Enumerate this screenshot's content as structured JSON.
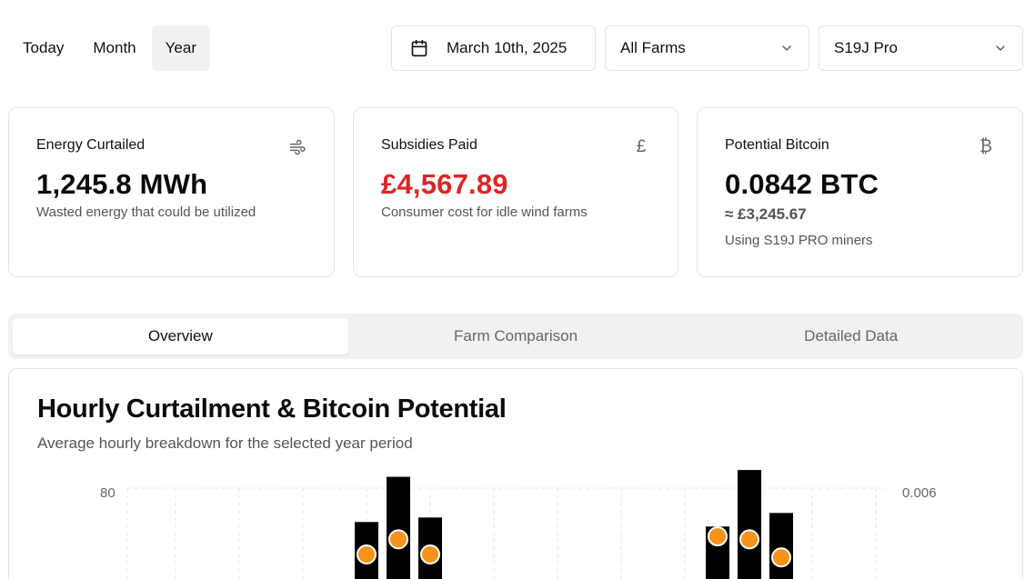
{
  "period_tabs": [
    {
      "label": "Today",
      "active": false
    },
    {
      "label": "Month",
      "active": false
    },
    {
      "label": "Year",
      "active": true
    }
  ],
  "date_picker": {
    "value": "March 10th, 2025",
    "icon": "calendar-icon"
  },
  "farm_select": {
    "value": "All Farms",
    "icon": "chevron-down-icon"
  },
  "model_select": {
    "value": "S19J Pro",
    "icon": "chevron-down-icon"
  },
  "cards": {
    "energy": {
      "title": "Energy Curtailed",
      "icon": "wind-icon",
      "value": "1,245.8 MWh",
      "subtitle": "Wasted energy that could be utilized"
    },
    "subsidies": {
      "title": "Subsidies Paid",
      "icon": "pound-icon",
      "icon_glyph": "£",
      "value": "£4,567.89",
      "value_color": "#dc2626",
      "subtitle": "Consumer cost for idle wind farms"
    },
    "bitcoin": {
      "title": "Potential Bitcoin",
      "icon": "bitcoin-icon",
      "icon_glyph": "₿",
      "value": "0.0842 BTC",
      "approx": "≈ £3,245.67",
      "note": "Using S19J PRO miners"
    }
  },
  "view_tabs": [
    {
      "label": "Overview",
      "active": true
    },
    {
      "label": "Farm Comparison",
      "active": false
    },
    {
      "label": "Detailed Data",
      "active": false
    }
  ],
  "chart": {
    "title": "Hourly Curtailment & Bitcoin Potential",
    "subtitle": "Average hourly breakdown for the selected year period"
  },
  "chart_data": {
    "type": "bar",
    "title": "Hourly Curtailment & Bitcoin Potential",
    "left_axis_max_label": "80",
    "right_axis_max_label": "0.006",
    "ylim_left": [
      0,
      80
    ],
    "ylim_right": [
      0,
      0.006
    ],
    "bar_color": "#000000",
    "point_color": "#f7931a",
    "series": [
      {
        "name": "",
        "values": [
          0,
          0,
          0,
          0,
          0,
          0,
          0,
          0,
          0,
          0,
          0,
          0,
          0,
          0,
          0,
          0,
          0,
          0,
          0,
          0,
          0,
          0,
          0,
          0
        ]
      }
    ],
    "visible_groups": [
      {
        "bars": [
          {
            "value": 65
          },
          {
            "value": 85
          },
          {
            "value": 67
          }
        ],
        "points": [
          0.0038,
          0.0043,
          0.0038
        ]
      },
      {
        "bars": [
          {
            "value": 63
          },
          {
            "value": 88
          },
          {
            "value": 69
          }
        ],
        "points": [
          0.0044,
          0.0043,
          0.0037
        ]
      }
    ],
    "grid": true
  }
}
